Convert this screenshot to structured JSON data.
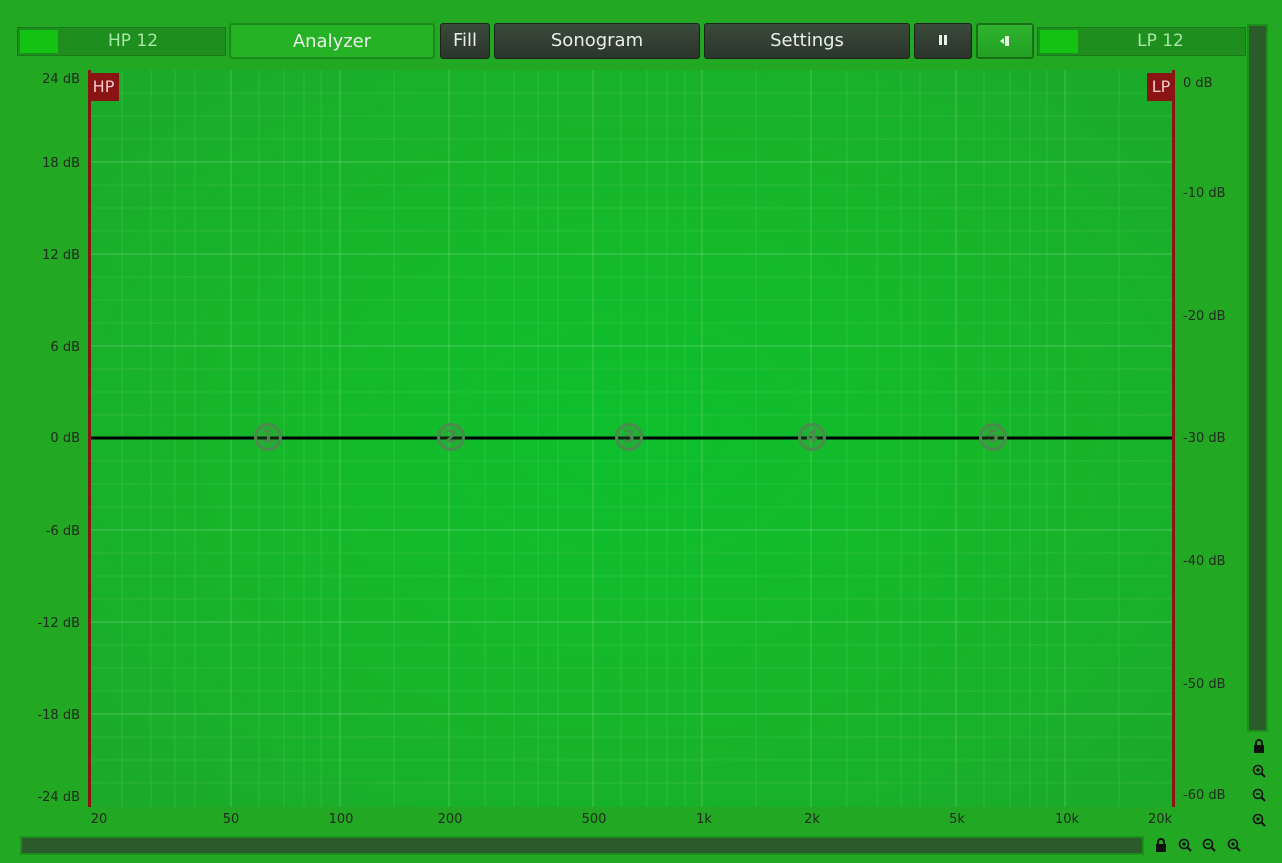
{
  "toolbar": {
    "hp_label": "HP 12",
    "lp_label": "LP 12",
    "analyzer": "Analyzer",
    "fill": "Fill",
    "sonogram": "Sonogram",
    "settings": "Settings",
    "pause_icon": "pause-icon",
    "reset_icon": "reset-icon"
  },
  "plot": {
    "hp_flag": "HP",
    "lp_flag": "LP",
    "left_axis": [
      "24 dB",
      "18 dB",
      "12 dB",
      "6 dB",
      "0 dB",
      "-6 dB",
      "-12 dB",
      "-18 dB",
      "-24 dB"
    ],
    "right_axis": [
      "0 dB",
      "-10 dB",
      "-20 dB",
      "-30 dB",
      "-40 dB",
      "-50 dB",
      "-60 dB"
    ],
    "freq_axis": [
      "20",
      "50",
      "100",
      "200",
      "500",
      "1k",
      "2k",
      "5k",
      "10k",
      "20k"
    ],
    "nodes": [
      "1",
      "2",
      "3",
      "4",
      "5"
    ]
  },
  "colors": {
    "background": "#23a823",
    "curve": "#000000",
    "filter_marker": "#8a1313"
  },
  "icons": [
    "lock-icon",
    "zoom-in-icon",
    "zoom-out-icon",
    "zoom-reset-icon"
  ]
}
